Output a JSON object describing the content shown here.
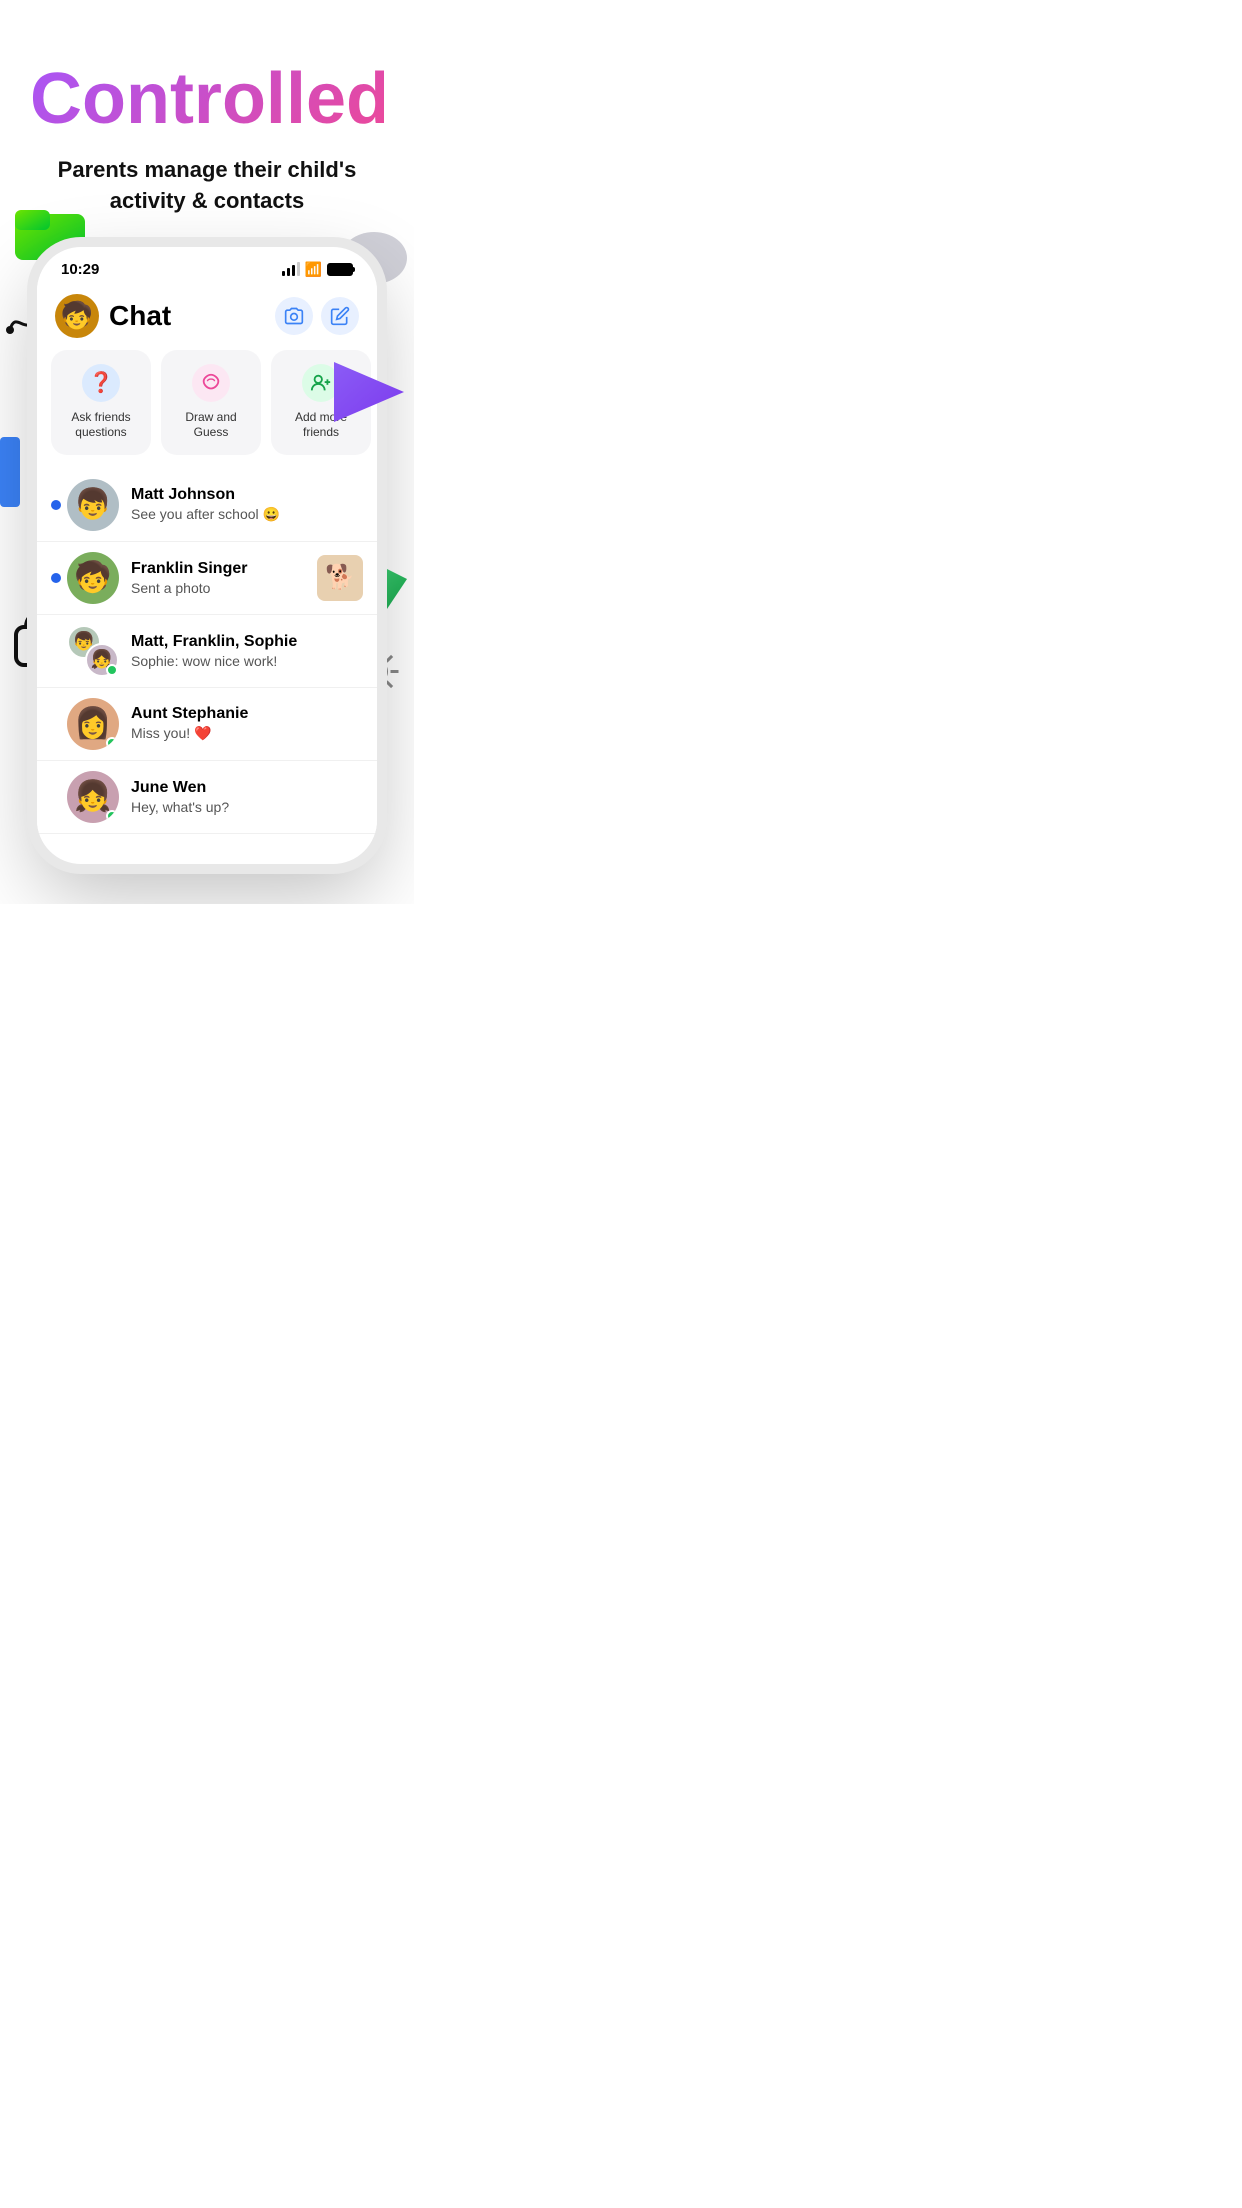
{
  "page": {
    "title": "Controlled",
    "subtitle": "Parents manage their child's activity & contacts"
  },
  "status_bar": {
    "time": "10:29"
  },
  "header": {
    "title": "Chat",
    "camera_label": "camera",
    "compose_label": "compose"
  },
  "quick_actions": [
    {
      "id": "ask-friends",
      "icon": "❓",
      "icon_bg": "#dbeafe",
      "label": "Ask friends\nquestions"
    },
    {
      "id": "draw-guess",
      "icon": "〰",
      "icon_bg": "#fce7f3",
      "label": "Draw and\nGuess"
    },
    {
      "id": "add-friends",
      "icon": "👤+",
      "icon_bg": "#dcfce7",
      "label": "Add more\nfriends"
    },
    {
      "id": "extra",
      "icon": "...",
      "icon_bg": "#f3f4f6",
      "label": ""
    }
  ],
  "chats": [
    {
      "id": "matt-johnson",
      "name": "Matt Johnson",
      "preview": "See you after school 😀",
      "unread": true,
      "has_thumb": false,
      "avatar_type": "single",
      "avatar_emoji": "👦",
      "avatar_color": "#b5c0c8"
    },
    {
      "id": "franklin-singer",
      "name": "Franklin Singer",
      "preview": "Sent a photo",
      "unread": true,
      "has_thumb": true,
      "thumb_emoji": "🐕",
      "avatar_type": "single",
      "avatar_emoji": "🧒",
      "avatar_color": "#7aad5c"
    },
    {
      "id": "group-chat",
      "name": "Matt, Franklin, Sophie",
      "preview": "Sophie: wow nice work!",
      "unread": false,
      "has_thumb": false,
      "avatar_type": "group",
      "online": true
    },
    {
      "id": "aunt-stephanie",
      "name": "Aunt Stephanie",
      "preview": "Miss you! ❤️",
      "unread": false,
      "has_thumb": false,
      "avatar_type": "single",
      "avatar_emoji": "👩",
      "avatar_color": "#e0a882",
      "online": true
    },
    {
      "id": "june-wen",
      "name": "June Wen",
      "preview": "Hey, what's up?",
      "unread": false,
      "has_thumb": false,
      "avatar_type": "single",
      "avatar_emoji": "👧",
      "avatar_color": "#c8a0b0",
      "online": true
    }
  ]
}
